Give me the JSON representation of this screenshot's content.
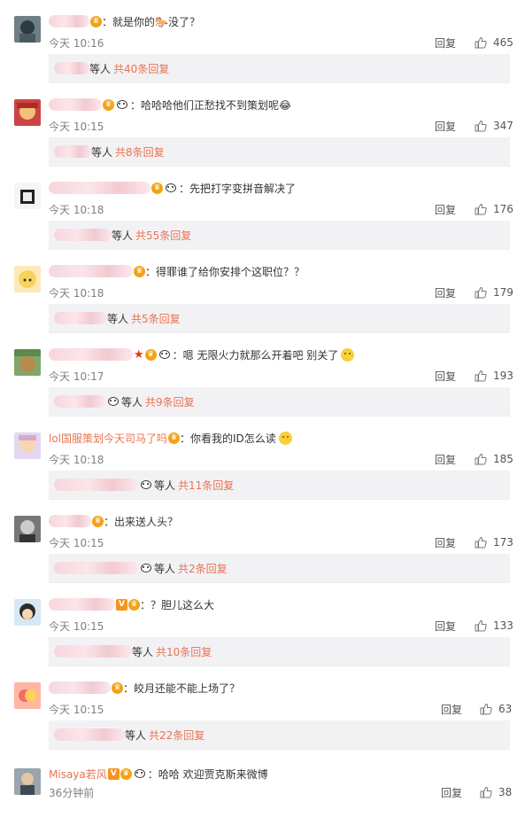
{
  "colors": {
    "accent": "#eb7350",
    "reply_bg": "#f2f2f5",
    "time": "#808080"
  },
  "comments": [
    {
      "username": "",
      "blur_w": 46,
      "badges": [
        "crown"
      ],
      "text": "：就是你的🐎没了？",
      "emoji": false,
      "time": "今天 10:16",
      "reply_label": "回复",
      "likes": "465",
      "replies_prefix_w": 40,
      "replies_panda": false,
      "replies_etc": "等人",
      "replies_more": "共40条回复",
      "avatar": "cat"
    },
    {
      "username": "",
      "blur_w": 60,
      "badges": [
        "crown",
        "panda"
      ],
      "text": "：哈哈哈他们正愁找不到策划呢😂",
      "emoji": false,
      "time": "今天 10:15",
      "reply_label": "回复",
      "likes": "347",
      "replies_prefix_w": 42,
      "replies_panda": false,
      "replies_etc": "等人",
      "replies_more": "共8条回复",
      "avatar": "red"
    },
    {
      "username": "",
      "blur_w": 115,
      "badges": [
        "crown",
        "panda"
      ],
      "text": "：先把打字变拼音解决了",
      "emoji": false,
      "time": "今天 10:18",
      "reply_label": "回复",
      "likes": "176",
      "replies_prefix_w": 65,
      "replies_panda": false,
      "replies_etc": "等人",
      "replies_more": "共55条回复",
      "avatar": "bw"
    },
    {
      "username": "",
      "blur_w": 95,
      "badges": [
        "crown"
      ],
      "text": "：得罪谁了给你安排个这职位？？",
      "emoji": false,
      "time": "今天 10:18",
      "reply_label": "回复",
      "likes": "179",
      "replies_prefix_w": 60,
      "replies_panda": false,
      "replies_etc": "等人",
      "replies_more": "共5条回复",
      "avatar": "anime"
    },
    {
      "username": "",
      "blur_w": 95,
      "badges": [
        "star",
        "crown",
        "panda"
      ],
      "text": "：嗯  无限火力就那么开着吧  别关了",
      "emoji": true,
      "time": "今天 10:17",
      "reply_label": "回复",
      "likes": "193",
      "replies_prefix_w": 58,
      "replies_panda": true,
      "replies_etc": "等人",
      "replies_more": "共9条回复",
      "avatar": "dog"
    },
    {
      "username": "lol国服策划今天司马了吗",
      "blur_w": 0,
      "badges": [
        "crown"
      ],
      "text": "：你看我的ID怎么读",
      "emoji": true,
      "time": "今天 10:18",
      "reply_label": "回复",
      "likes": "185",
      "replies_prefix_w": 95,
      "replies_panda": true,
      "replies_etc": "等人",
      "replies_more": "共11条回复",
      "avatar": "girl"
    },
    {
      "username": "",
      "blur_w": 48,
      "badges": [
        "crown"
      ],
      "text": "：出来送人头？",
      "emoji": false,
      "time": "今天 10:15",
      "reply_label": "回复",
      "likes": "173",
      "replies_prefix_w": 95,
      "replies_panda": true,
      "replies_etc": "等人",
      "replies_more": "共2条回复",
      "avatar": "man"
    },
    {
      "username": "",
      "blur_w": 75,
      "badges": [
        "v",
        "crown"
      ],
      "text": "：？胆儿这么大",
      "emoji": false,
      "time": "今天 10:15",
      "reply_label": "回复",
      "likes": "133",
      "replies_prefix_w": 88,
      "replies_panda": false,
      "replies_etc": "等人",
      "replies_more": "共10条回复",
      "avatar": "cartoon"
    },
    {
      "username": "",
      "blur_w": 70,
      "badges": [
        "crown"
      ],
      "text": "：皎月还能不能上场了？",
      "emoji": false,
      "time": "今天 10:15",
      "reply_label": "回复",
      "likes": "63",
      "replies_prefix_w": 80,
      "replies_panda": false,
      "replies_etc": "等人",
      "replies_more": "共22条回复",
      "avatar": "bright"
    },
    {
      "username": "Misaya若风",
      "blur_w": 0,
      "badges": [
        "v",
        "crown",
        "panda"
      ],
      "text": "：哈哈  欢迎贾克斯来微博",
      "emoji": false,
      "time": "36分钟前",
      "reply_label": "回复",
      "likes": "38",
      "replies_prefix_w": 0,
      "replies_panda": false,
      "replies_etc": "",
      "replies_more": "",
      "avatar": "photo"
    }
  ]
}
